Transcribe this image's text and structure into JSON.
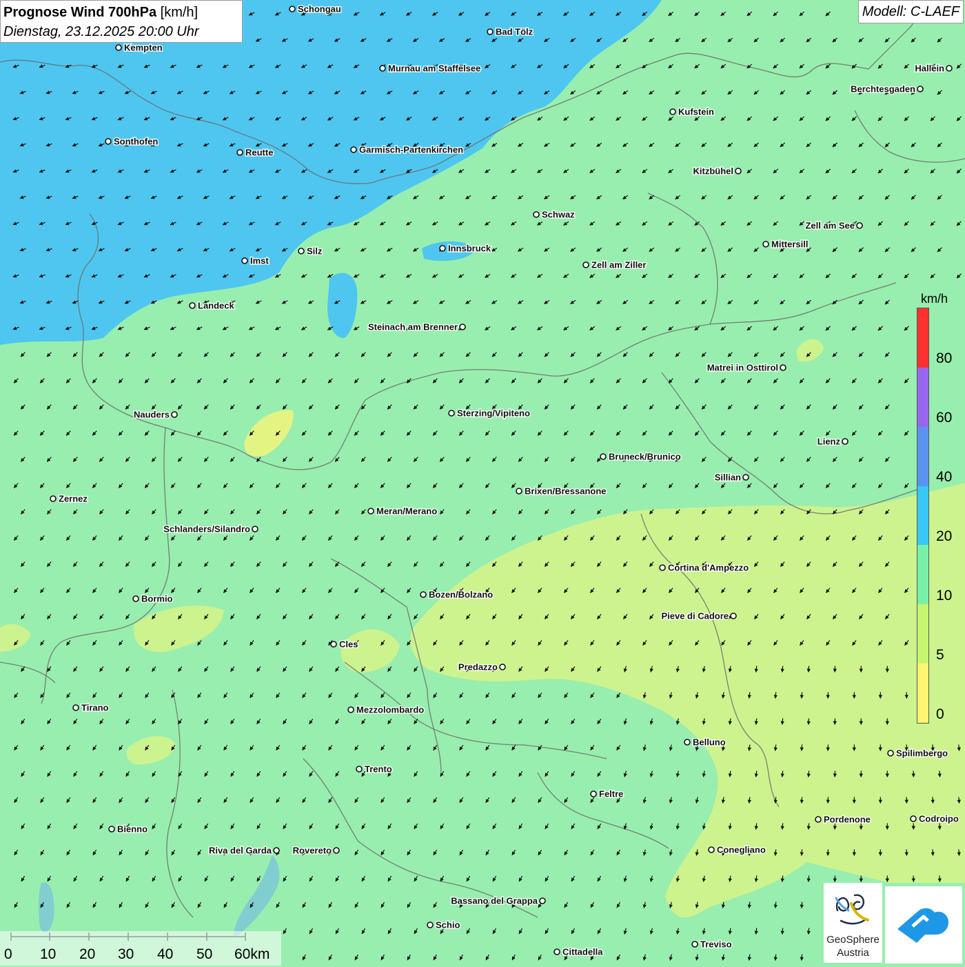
{
  "header": {
    "title_bold": "Prognose Wind 700hPa",
    "title_unit": " [km/h]",
    "subtitle": "Dienstag, 23.12.2025 20:00 Uhr"
  },
  "model_label": "Modell: C-LAEF",
  "legend": {
    "unit": "km/h",
    "colors": [
      "#ff3030",
      "#9966ee",
      "#5a94f0",
      "#38c8f5",
      "#78f0a8",
      "#c8f570",
      "#fff570"
    ],
    "ticks": [
      "80",
      "60",
      "40",
      "20",
      "10",
      "5",
      "0"
    ]
  },
  "scale": {
    "ticks": [
      "0",
      "10",
      "20",
      "30",
      "40",
      "50",
      "60km"
    ]
  },
  "logos": {
    "geosphere_line1": "GeoSphere",
    "geosphere_line2": "Austria",
    "geosphere_icon": "geosphere-swirl-icon",
    "partner_icon": "blue-arrow-cloud-icon"
  },
  "map": {
    "colors": {
      "base_green": "#98eeae",
      "blue_zone": "#4fc6ef",
      "yellow_zone": "#cdf38e",
      "pale_yellow": "#e4f483",
      "border": "#6b6b6b"
    },
    "cities": [
      {
        "name": "Schongau",
        "lx": "right"
      },
      {
        "name": "Bad Tölz",
        "lx": "right"
      },
      {
        "name": "Kempten",
        "lx": "right"
      },
      {
        "name": "Murnau am Staffelsee",
        "lx": "right"
      },
      {
        "name": "Hallein",
        "lx": "left"
      },
      {
        "name": "Berchtesgaden",
        "lx": "left"
      },
      {
        "name": "Kufstein",
        "lx": "right"
      },
      {
        "name": "Sonthofen",
        "lx": "right"
      },
      {
        "name": "Reutte",
        "lx": "right"
      },
      {
        "name": "Garmisch-Partenkirchen",
        "lx": "right"
      },
      {
        "name": "Kitzbühel",
        "lx": "left"
      },
      {
        "name": "Schwaz",
        "lx": "right"
      },
      {
        "name": "Zell am See",
        "lx": "left"
      },
      {
        "name": "Mittersill",
        "lx": "right"
      },
      {
        "name": "Innsbruck",
        "lx": "right"
      },
      {
        "name": "Silz",
        "lx": "right"
      },
      {
        "name": "Imst",
        "lx": "right"
      },
      {
        "name": "Zell am Ziller",
        "lx": "right"
      },
      {
        "name": "Landeck",
        "lx": "right"
      },
      {
        "name": "Steinach am Brenner",
        "lx": "left"
      },
      {
        "name": "Matrei in Osttirol",
        "lx": "left"
      },
      {
        "name": "Nauders",
        "lx": "left"
      },
      {
        "name": "Sterzing/Vipiteno",
        "lx": "right"
      },
      {
        "name": "Lienz",
        "lx": "left"
      },
      {
        "name": "Bruneck/Brunico",
        "lx": "right"
      },
      {
        "name": "Sillian",
        "lx": "left"
      },
      {
        "name": "Zernez",
        "lx": "right"
      },
      {
        "name": "Brixen/Bressanone",
        "lx": "right"
      },
      {
        "name": "Meran/Merano",
        "lx": "right"
      },
      {
        "name": "Schlanders/Silandro",
        "lx": "left"
      },
      {
        "name": "Cortina d'Ampezzo",
        "lx": "right"
      },
      {
        "name": "Bozen/Bolzano",
        "lx": "right"
      },
      {
        "name": "Bormio",
        "lx": "right"
      },
      {
        "name": "Pieve di Cadore",
        "lx": "left"
      },
      {
        "name": "Cles",
        "lx": "right"
      },
      {
        "name": "Predazzo",
        "lx": "left"
      },
      {
        "name": "Tirano",
        "lx": "right"
      },
      {
        "name": "Mezzolombardo",
        "lx": "right"
      },
      {
        "name": "Belluno",
        "lx": "right"
      },
      {
        "name": "Spilimbergo",
        "lx": "right"
      },
      {
        "name": "Trento",
        "lx": "right"
      },
      {
        "name": "Feltre",
        "lx": "right"
      },
      {
        "name": "Pordenone",
        "lx": "right"
      },
      {
        "name": "Codroipo",
        "lx": "right"
      },
      {
        "name": "Bienno",
        "lx": "right"
      },
      {
        "name": "Riva del Garda",
        "lx": "left"
      },
      {
        "name": "Rovereto",
        "lx": "left"
      },
      {
        "name": "Conegliano",
        "lx": "right"
      },
      {
        "name": "Bassano del Grappa",
        "lx": "left"
      },
      {
        "name": "Schio",
        "lx": "right"
      },
      {
        "name": "Treviso",
        "lx": "right"
      },
      {
        "name": "Cittadella",
        "lx": "right"
      }
    ]
  }
}
